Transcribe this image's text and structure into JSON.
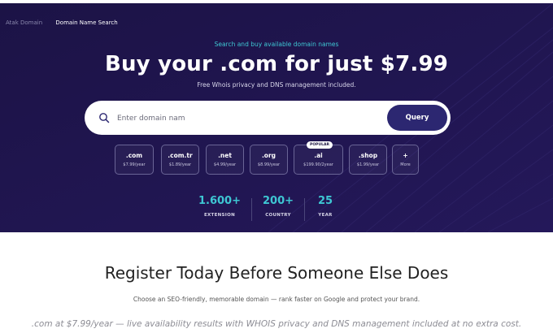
{
  "breadcrumb": {
    "home": "Atak Domain",
    "current": "Domain Name Search"
  },
  "hero": {
    "kicker": "Search and buy available domain names",
    "headline": "Buy your .com for just $7.99",
    "description": "Free Whois privacy and DNS management included."
  },
  "search": {
    "placeholder": "Enter domain nam",
    "button_label": "Query"
  },
  "tlds": [
    {
      "name": ".com",
      "price": "$7.99/year"
    },
    {
      "name": ".com.tr",
      "price": "$1.89/year"
    },
    {
      "name": ".net",
      "price": "$4.99/year"
    },
    {
      "name": ".org",
      "price": "$8.99/year"
    },
    {
      "name": ".ai",
      "price": "$199.90/2year",
      "badge": "POPULAR"
    },
    {
      "name": ".shop",
      "price": "$1.99/year"
    },
    {
      "name": "+",
      "price": "More"
    }
  ],
  "stats": [
    {
      "value": "1.600+",
      "label": "EXTENSION"
    },
    {
      "value": "200+",
      "label": "COUNTRY"
    },
    {
      "value": "25",
      "label": "YEAR"
    }
  ],
  "section": {
    "title": "Register Today Before Someone Else Does",
    "subtitle": "Choose an SEO-friendly, memorable domain — rank faster on Google and protect your brand.",
    "note": ".com at $7.99/year — live availability results with WHOIS privacy and DNS management included at no extra cost."
  },
  "colors": {
    "hero_bg": "#1a1240",
    "accent_teal": "#3ec7d3",
    "button_bg": "#2c2771"
  }
}
